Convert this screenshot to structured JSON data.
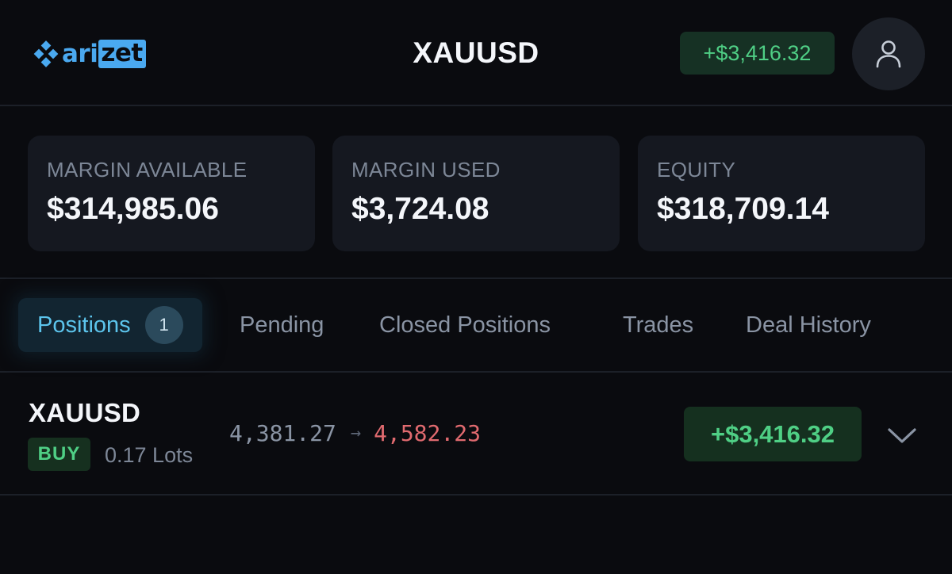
{
  "brand": {
    "logo_text_a": "ari",
    "logo_text_b": "zet",
    "color": "#4aa9f0"
  },
  "header": {
    "symbol": "XAUUSD",
    "total_pnl": "+$3,416.32",
    "profile_icon": "user-icon"
  },
  "stats": [
    {
      "label": "MARGIN AVAILABLE",
      "value": "$314,985.06"
    },
    {
      "label": "MARGIN USED",
      "value": "$3,724.08"
    },
    {
      "label": "EQUITY",
      "value": "$318,709.14"
    }
  ],
  "tabs": [
    {
      "label": "Positions",
      "count": "1",
      "active": true
    },
    {
      "label": "Pending"
    },
    {
      "label": "Closed Positions"
    },
    {
      "label": "Trades"
    },
    {
      "label": "Deal History"
    }
  ],
  "positions": [
    {
      "symbol": "XAUUSD",
      "side": "BUY",
      "lots": "0.17 Lots",
      "open_price": "4,381.27",
      "current_price": "4,582.23",
      "pnl": "+$3,416.32",
      "expand_icon": "chevron-down-icon"
    }
  ],
  "colors": {
    "background": "#0a0b0f",
    "card": "#151820",
    "profit": "#4fcf85",
    "loss": "#e06a6f",
    "active_tab": "#5cc4ec"
  }
}
